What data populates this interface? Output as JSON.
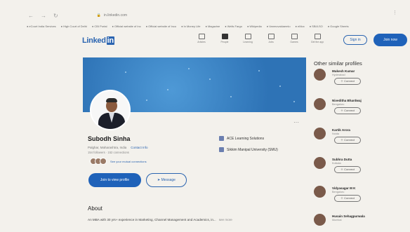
{
  "browser": {
    "nav": [
      "←",
      "→",
      "↻"
    ],
    "url": "in.linkedin.com",
    "bookmarks": [
      "eCourt India Services",
      "High Court of Delhi",
      "CBI Portal",
      "Official website of Inc",
      "Official website of Inco",
      "In Money Life",
      "Magazine",
      "Wells Fargo",
      "Wikipedia",
      "Vanmovakiaemlo",
      "eMox",
      "SBI/LSO",
      "Google Sheets"
    ]
  },
  "header": {
    "logo_text": "Linked",
    "logo_in": "in",
    "nav": [
      {
        "label": "Articles",
        "icon": "articles-icon",
        "active": false
      },
      {
        "label": "People",
        "icon": "people-icon",
        "active": true
      },
      {
        "label": "Learning",
        "icon": "learning-icon",
        "active": false
      },
      {
        "label": "Jobs",
        "icon": "jobs-icon",
        "active": false
      },
      {
        "label": "Games",
        "icon": "games-icon",
        "active": false
      },
      {
        "label": "Get the app",
        "icon": "get-app-icon",
        "active": false
      }
    ],
    "signin": "Sign in",
    "join": "Join now"
  },
  "profile": {
    "name": "Subodh Sinha",
    "location": "Palghar, Maharashtra, India",
    "contact": "Contact Info",
    "connections": "154 followers · 152 connections",
    "mutual": "See your mutual connections",
    "view_btn": "Join to view profile",
    "msg_btn": "Message",
    "orgs": [
      "ACE Learning Solutions",
      "Sikkim Manipal University (SMU)"
    ]
  },
  "about": {
    "title": "About",
    "text": "An MBA with 30 yrs+ experience in Marketing, Channel Management and Academics, in...",
    "more": "see more"
  },
  "sidebar": {
    "title": "Other similar profiles",
    "connect_label": "Connect",
    "profiles": [
      {
        "name": "Mukesh Kumar",
        "loc": "Hyderabad"
      },
      {
        "name": "Niveditha Bhardwaj",
        "loc": "Bengaluru"
      },
      {
        "name": "Kartik Arora",
        "loc": "Noida"
      },
      {
        "name": "Subhra Dutta",
        "loc": "Kolkata"
      },
      {
        "name": "Vidyasagar M K",
        "loc": "Bengaluru"
      },
      {
        "name": "Husain Sehagpurwala",
        "loc": "Mumbai"
      }
    ]
  }
}
